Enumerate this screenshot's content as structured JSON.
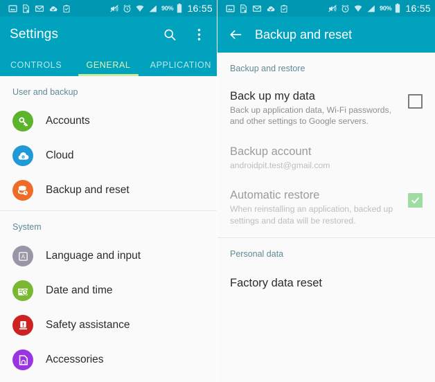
{
  "colors": {
    "statusbar_bg": "#0097b2",
    "appbar_bg": "#00a2bd",
    "tab_active": "#dff3b8",
    "tab_indicator": "#cdeb9c",
    "pane_bg": "#fafafa",
    "section_header": "#5f8a96",
    "checkbox_checked": "#9fdca4",
    "accounts_icon": "#5cb42c",
    "cloud_icon": "#1f9ad6",
    "backup_icon": "#ee6c25",
    "language_icon": "#9b95a8",
    "date_icon": "#7ab833",
    "safety_icon": "#cc2222",
    "accessories_icon": "#9a34e0"
  },
  "status_bar": {
    "left_icons": [
      {
        "name": "photo-icon",
        "glyph": "image"
      },
      {
        "name": "document-unavailable-icon",
        "glyph": "doc-x"
      },
      {
        "name": "email-icon",
        "glyph": "envelope"
      },
      {
        "name": "cloud-sync-complete-icon",
        "glyph": "cloud-check"
      },
      {
        "name": "clipboard-check-icon",
        "glyph": "clipboard"
      }
    ],
    "right_icons": [
      {
        "name": "volume-mute-icon",
        "glyph": "mute"
      },
      {
        "name": "alarm-clock-icon",
        "glyph": "alarm"
      },
      {
        "name": "wifi-icon",
        "glyph": "wifi"
      },
      {
        "name": "cellular-signal-icon",
        "glyph": "signal"
      }
    ],
    "battery_percent": "90%",
    "time": "16:55"
  },
  "left_screen": {
    "app_bar": {
      "title": "Settings",
      "search_icon": "search-icon",
      "overflow_icon": "more-vertical-icon"
    },
    "tabs": [
      {
        "label": "CONTROLS",
        "active": false
      },
      {
        "label": "GENERAL",
        "active": true
      },
      {
        "label": "APPLICATION",
        "active": false
      }
    ],
    "sections": [
      {
        "header": "User and backup",
        "items": [
          {
            "label": "Accounts",
            "icon": "key-icon",
            "color": "#5cb42c"
          },
          {
            "label": "Cloud",
            "icon": "cloud-icon",
            "color": "#1f9ad6"
          },
          {
            "label": "Backup and reset",
            "icon": "database-restore-icon",
            "color": "#ee6c25"
          }
        ]
      },
      {
        "header": "System",
        "items": [
          {
            "label": "Language and input",
            "icon": "letter-a-icon",
            "color": "#9b95a8"
          },
          {
            "label": "Date and time",
            "icon": "calendar-clock-icon",
            "color": "#7ab833"
          },
          {
            "label": "Safety assistance",
            "icon": "warning-icon",
            "color": "#cc2222"
          },
          {
            "label": "Accessories",
            "icon": "headphone-device-icon",
            "color": "#9a34e0"
          }
        ]
      }
    ]
  },
  "right_screen": {
    "app_bar": {
      "back_icon": "back-arrow-icon",
      "title": "Backup and reset"
    },
    "sections": [
      {
        "header": "Backup and restore",
        "items": [
          {
            "title": "Back up my data",
            "subtitle": "Back up application data, Wi-Fi passwords, and other settings to Google servers.",
            "checkbox": "unchecked",
            "disabled": false
          },
          {
            "title": "Backup account",
            "subtitle": "androidpit.test@gmail.com",
            "checkbox": "none",
            "disabled": true
          },
          {
            "title": "Automatic restore",
            "subtitle": "When reinstalling an application, backed up settings and data will be restored.",
            "checkbox": "checked",
            "disabled": true
          }
        ]
      },
      {
        "header": "Personal data",
        "items": [
          {
            "title": "Factory data reset",
            "subtitle": "",
            "checkbox": "none",
            "disabled": false
          }
        ]
      }
    ]
  }
}
